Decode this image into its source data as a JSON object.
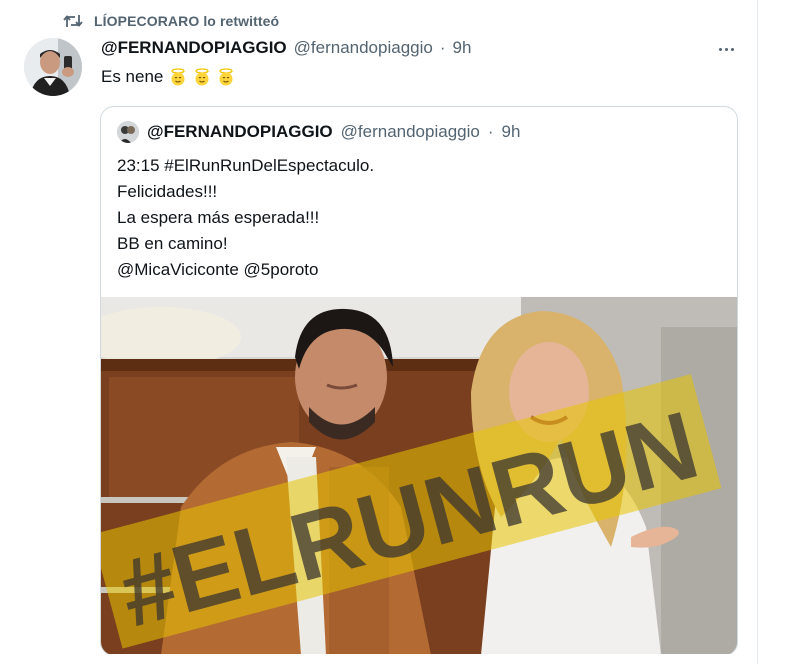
{
  "retweet": {
    "icon": "retweet-icon",
    "text": "LÍOPECORARO lo retwitteó"
  },
  "tweet": {
    "display_name": "@FERNANDOPIAGGIO",
    "handle": "@fernandopiaggio",
    "separator": "·",
    "time": "9h",
    "text": "Es nene",
    "emoji_icon": "angel-face-icon",
    "more_icon": "more-options-icon"
  },
  "quoted_tweet": {
    "display_name": "@FERNANDOPIAGGIO",
    "handle": "@fernandopiaggio",
    "separator": "·",
    "time": "9h",
    "lines": [
      "23:15 #ElRunRunDelEspectaculo.",
      "Felicidades!!!",
      "La espera más esperada!!!",
      "BB en camino!",
      "@MicaViciconte @5poroto"
    ],
    "image": {
      "watermark": "#ELRUNRUN",
      "watermark_color": "#e8c400"
    }
  },
  "colors": {
    "text_primary": "#0f1419",
    "text_secondary": "#536471",
    "border": "#cfd9de"
  }
}
